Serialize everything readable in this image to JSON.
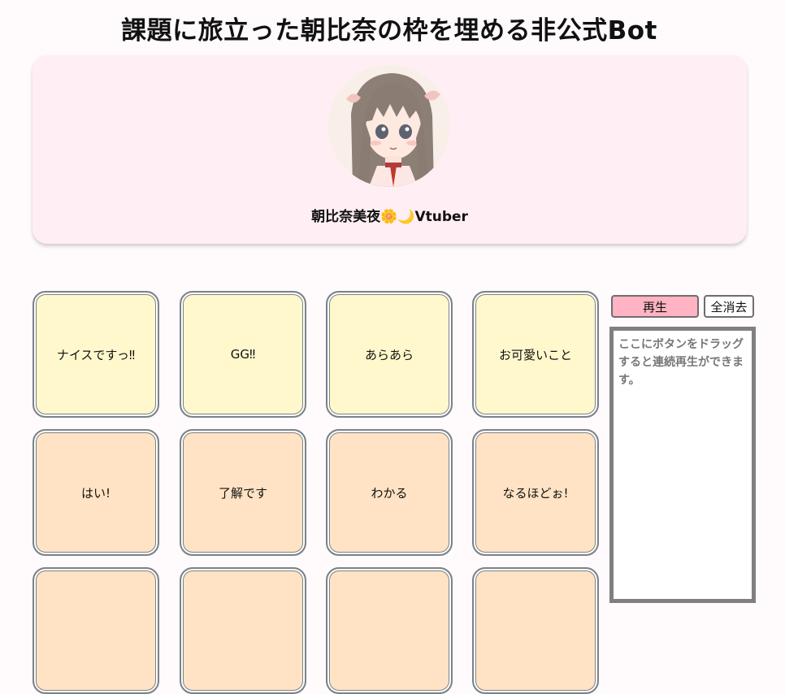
{
  "page_title": "課題に旅立った朝比奈の枠を埋める非公式Bot",
  "profile": {
    "name": "朝比奈美夜",
    "emojis": "🌼🌙",
    "suffix": "Vtuber"
  },
  "controls": {
    "play_label": "再生",
    "clear_label": "全消去",
    "drop_hint": "ここにボタンをドラッグすると連続再生ができます。"
  },
  "colors": {
    "accent_pink": "#ffb3c3",
    "card_bg": "#ffeef4",
    "tile_yellow": "#fff8cc",
    "tile_peach": "#ffe3c4"
  },
  "buttons": [
    {
      "label": "ナイスですっ‼",
      "color": "yellow"
    },
    {
      "label": "GG‼",
      "color": "yellow"
    },
    {
      "label": "あらあら",
      "color": "yellow"
    },
    {
      "label": "お可愛いこと",
      "color": "yellow"
    },
    {
      "label": "はい!",
      "color": "peach"
    },
    {
      "label": "了解です",
      "color": "peach"
    },
    {
      "label": "わかる",
      "color": "peach"
    },
    {
      "label": "なるほどぉ!",
      "color": "peach"
    },
    {
      "label": "",
      "color": "peach"
    },
    {
      "label": "",
      "color": "peach"
    },
    {
      "label": "",
      "color": "peach"
    },
    {
      "label": "",
      "color": "peach"
    }
  ]
}
